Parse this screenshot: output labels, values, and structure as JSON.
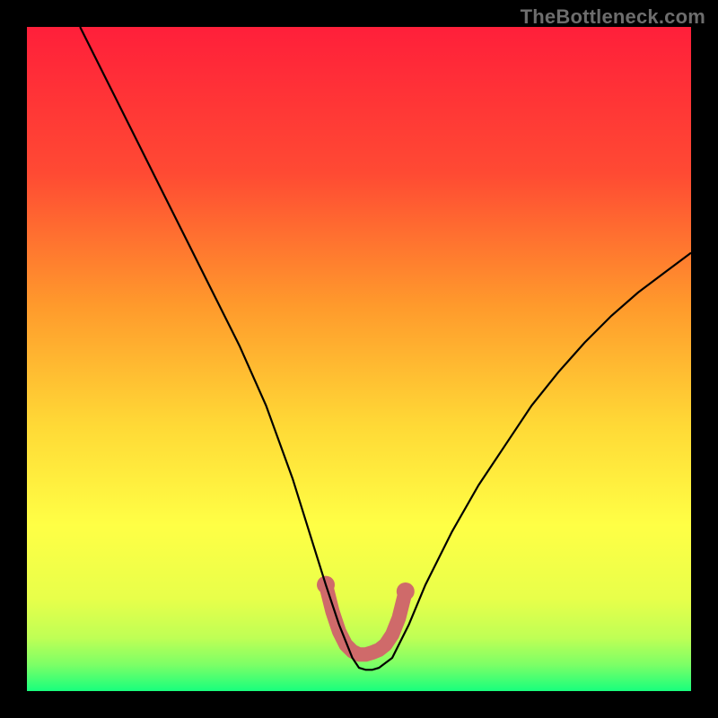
{
  "watermark": "TheBottleneck.com",
  "chart_data": {
    "type": "line",
    "title": "",
    "xlabel": "",
    "ylabel": "",
    "xlim": [
      0,
      100
    ],
    "ylim": [
      0,
      100
    ],
    "grid": false,
    "series": [
      {
        "name": "bottleneck-curve",
        "x": [
          8,
          12,
          16,
          20,
          24,
          28,
          32,
          36,
          40,
          42.5,
          45,
          47,
          49,
          50,
          51,
          52,
          53,
          55,
          57.5,
          60,
          64,
          68,
          72,
          76,
          80,
          84,
          88,
          92,
          96,
          100
        ],
        "y": [
          100,
          92,
          84,
          76,
          68,
          60,
          52,
          43,
          32,
          24,
          16,
          10,
          5,
          3.5,
          3.2,
          3.2,
          3.5,
          5,
          10,
          16,
          24,
          31,
          37,
          43,
          48,
          52.5,
          56.5,
          60,
          63,
          66
        ]
      },
      {
        "name": "optimal-band",
        "x": [
          45,
          46,
          47,
          48,
          49,
          50,
          51,
          52,
          53,
          54,
          55,
          56,
          57
        ],
        "y": [
          16,
          12,
          9,
          7,
          6,
          5.5,
          5.5,
          5.8,
          6.2,
          7,
          8.5,
          11,
          15
        ]
      }
    ],
    "annotations": []
  },
  "colors": {
    "gradient_top": "#ff1f3a",
    "gradient_upper_mid": "#ff6a2a",
    "gradient_mid": "#ffe63a",
    "gradient_lower_mid": "#d8ff3a",
    "gradient_bottom": "#18ff7d",
    "curve": "#000000",
    "band": "#cf6a6a",
    "band_dot": "#cf6a6a",
    "frame": "#000000",
    "watermark": "#6d6d6d"
  }
}
